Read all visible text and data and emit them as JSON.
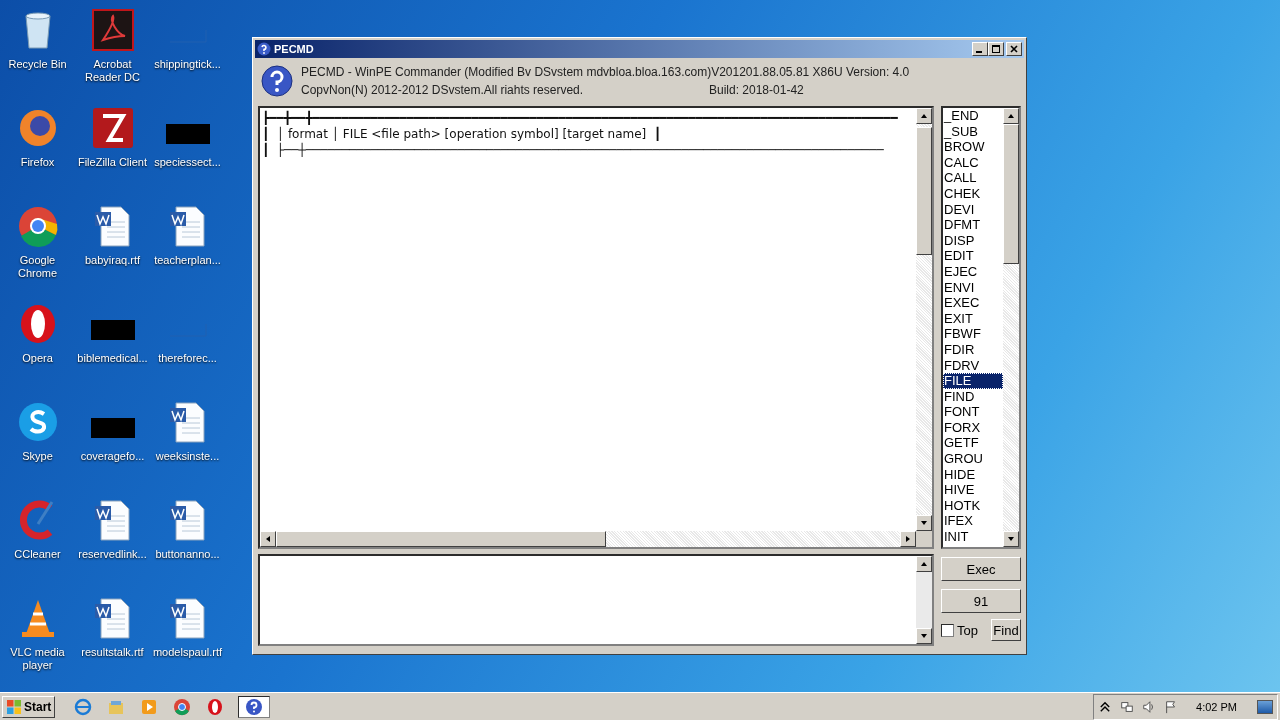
{
  "desktop_icons": [
    {
      "label": "Recycle Bin",
      "kind": "recycle"
    },
    {
      "label": "Acrobat Reader DC",
      "kind": "pdf"
    },
    {
      "label": "shippingtick...",
      "kind": "blank"
    },
    {
      "label": "Firefox",
      "kind": "firefox"
    },
    {
      "label": "FileZilla Client",
      "kind": "filezilla"
    },
    {
      "label": "speciessect...",
      "kind": "black"
    },
    {
      "label": "Google Chrome",
      "kind": "chrome"
    },
    {
      "label": "babyiraq.rtf",
      "kind": "word"
    },
    {
      "label": "teacherplan...",
      "kind": "word"
    },
    {
      "label": "Opera",
      "kind": "opera"
    },
    {
      "label": "biblemedical...",
      "kind": "black"
    },
    {
      "label": "thereforec...",
      "kind": "blank"
    },
    {
      "label": "Skype",
      "kind": "skype"
    },
    {
      "label": "coveragefo...",
      "kind": "black"
    },
    {
      "label": "weeksinste...",
      "kind": "word"
    },
    {
      "label": "CCleaner",
      "kind": "ccleaner"
    },
    {
      "label": "reservedlink...",
      "kind": "word"
    },
    {
      "label": "buttonanno...",
      "kind": "word"
    },
    {
      "label": "VLC media player",
      "kind": "vlc"
    },
    {
      "label": "resultstalk.rtf",
      "kind": "word"
    },
    {
      "label": "modelspaul.rtf",
      "kind": "word"
    }
  ],
  "window": {
    "title": "PECMD",
    "header_line_1": "PECMD - WinPE Commander (Modified Bv DSvstem mdvbloa.bloa.163.com)V201201.88.05.81 X86U  Version: 4.0",
    "copyright": "CopvNon(N) 2012-2012 DSvstem.All riahts reserved.",
    "build": "Build: 2018-01-42",
    "editor_lines": [
      "┣━━╋━━╋━━━━━━━━━━━━━━━━━━━━━━━━━━━━━━━━━━━━━━━━━━━━━━━━━━━━━━━━━━━━━━━━━━━━━━━━━━━━━━━━━",
      "┃  │ format │ FILE <file path> [operation symbol] [target name]  ┃",
      "┃  ├──┼────────────────────────────────────────────────────────────────────────────────"
    ],
    "commands": [
      {
        "label": "_END",
        "selected": false
      },
      {
        "label": "_SUB",
        "selected": false
      },
      {
        "label": "BROW",
        "selected": false
      },
      {
        "label": "CALC",
        "selected": false
      },
      {
        "label": "CALL",
        "selected": false
      },
      {
        "label": "CHEK",
        "selected": false
      },
      {
        "label": "DEVI",
        "selected": false
      },
      {
        "label": "DFMT",
        "selected": false
      },
      {
        "label": "DISP",
        "selected": false
      },
      {
        "label": "EDIT",
        "selected": false
      },
      {
        "label": "EJEC",
        "selected": false
      },
      {
        "label": "ENVI",
        "selected": false
      },
      {
        "label": "EXEC",
        "selected": false
      },
      {
        "label": "EXIT",
        "selected": false
      },
      {
        "label": "FBWF",
        "selected": false
      },
      {
        "label": "FDIR",
        "selected": false
      },
      {
        "label": "FDRV",
        "selected": false
      },
      {
        "label": "FILE",
        "selected": true
      },
      {
        "label": "FIND",
        "selected": false
      },
      {
        "label": "FONT",
        "selected": false
      },
      {
        "label": "FORX",
        "selected": false
      },
      {
        "label": "GETF",
        "selected": false
      },
      {
        "label": "GROU",
        "selected": false
      },
      {
        "label": "HIDE",
        "selected": false
      },
      {
        "label": "HIVE",
        "selected": false
      },
      {
        "label": "HOTK",
        "selected": false
      },
      {
        "label": "IFEX",
        "selected": false
      },
      {
        "label": "INIT",
        "selected": false
      }
    ],
    "exec_button": "Exec",
    "count_button": "91",
    "top_checkbox": {
      "label": "Top",
      "checked": false
    },
    "find_button": "Find"
  },
  "taskbar": {
    "start": "Start",
    "apps": [
      {
        "kind": "ie",
        "selected": false
      },
      {
        "kind": "explorer",
        "selected": false
      },
      {
        "kind": "media",
        "selected": false
      },
      {
        "kind": "chrome",
        "selected": false
      },
      {
        "kind": "opera",
        "selected": false
      },
      {
        "kind": "pecmd",
        "selected": true
      }
    ],
    "clock": "4:02 PM"
  }
}
